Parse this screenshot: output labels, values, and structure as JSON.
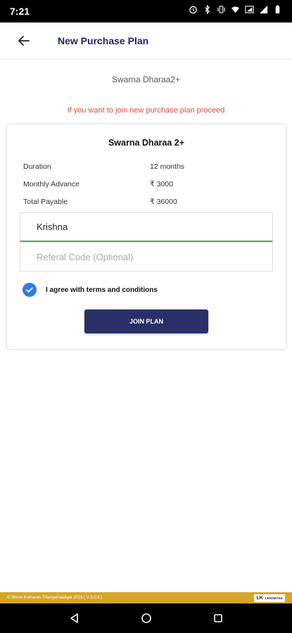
{
  "status_bar": {
    "time": "7:21",
    "icons": [
      "alarm-icon",
      "bluetooth-icon",
      "vibrate-icon",
      "wifi-icon",
      "signal-icon",
      "signal-icon",
      "battery-icon"
    ]
  },
  "app_bar": {
    "title": "New Purchase Plan",
    "back_icon": "arrow-left-icon"
  },
  "plan_name": "Swarna Dharaa2+",
  "notice": "If you want to join new purchase plan proceed",
  "card": {
    "title": "Swarna Dharaa 2+",
    "rows": [
      {
        "label": "Duration",
        "value": "12 months"
      },
      {
        "label": "Monthly Advance",
        "value": "₹ 3000"
      },
      {
        "label": "Total Payable",
        "value": "₹ 36000"
      }
    ],
    "name_field": {
      "value": "Krishna"
    },
    "referral_field": {
      "placeholder": "Referal Code (Optional)"
    },
    "agree_label": "I agree with terms and conditions",
    "agree_checked": true,
    "join_button": "JOIN PLAN"
  },
  "footer": {
    "copyright": "© Shree Kumaran Thangamaaligai 2023 ( V 3.0.8 )",
    "logo_mark": "LK",
    "logo_text": "LENSMAKE"
  },
  "colors": {
    "primary": "#2b2f67",
    "title": "#1f2566",
    "notice": "#e04a3f",
    "checkbox": "#2f7bec",
    "footer": "#d7a527",
    "input_focus": "#4caf50"
  },
  "nav_bar": {
    "icons": [
      "back-triangle-icon",
      "home-circle-icon",
      "recents-square-icon"
    ]
  }
}
